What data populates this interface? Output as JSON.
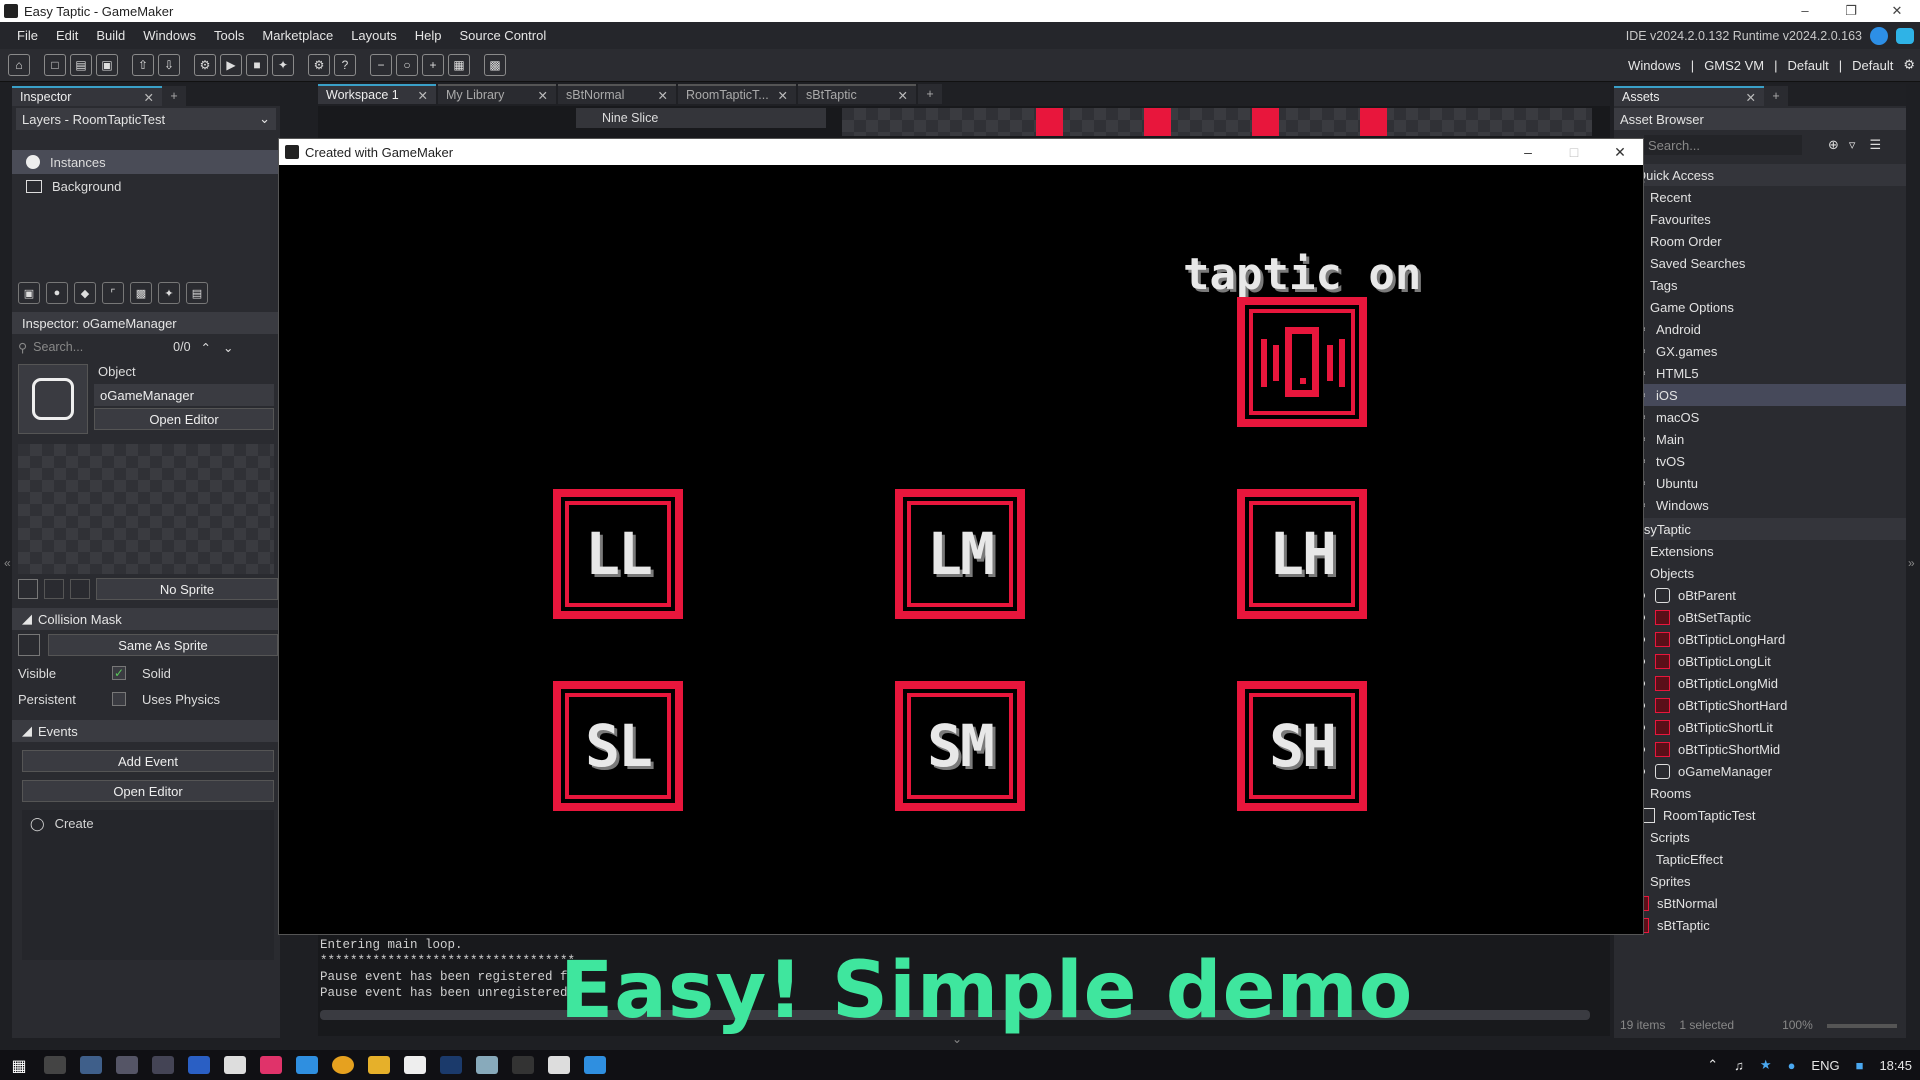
{
  "window": {
    "title": "Easy Taptic - GameMaker"
  },
  "menu": {
    "items": [
      "File",
      "Edit",
      "Build",
      "Windows",
      "Tools",
      "Marketplace",
      "Layouts",
      "Help",
      "Source Control"
    ],
    "version": "IDE v2024.2.0.132  Runtime v2024.2.0.163"
  },
  "toolbar": {
    "targets": [
      "Windows",
      "|",
      "GMS2 VM",
      "|",
      "Default",
      "|",
      "Default"
    ]
  },
  "left": {
    "inspector_tab": "Inspector",
    "layers_dropdown": "Layers - RoomTapticTest",
    "layers": [
      {
        "label": "Instances",
        "selected": true
      },
      {
        "label": "Background",
        "selected": false
      }
    ],
    "inspector_header": "Inspector: oGameManager",
    "search_placeholder": "Search...",
    "search_count": "0/0",
    "object_label": "Object",
    "object_name": "oGameManager",
    "open_editor": "Open Editor",
    "no_sprite": "No Sprite",
    "collision_mask": "Collision Mask",
    "same_as_sprite": "Same As Sprite",
    "visible": "Visible",
    "solid": "Solid",
    "persistent": "Persistent",
    "uses_physics": "Uses Physics",
    "events": "Events",
    "add_event": "Add Event",
    "open_editor2": "Open Editor",
    "event_create": "Create"
  },
  "workspace": {
    "tabs": [
      "Workspace 1",
      "My Library",
      "sBtNormal",
      "RoomTapticT...",
      "sBtTaptic"
    ],
    "nine_slice": "Nine Slice",
    "output": [
      "Entering main loop.",
      "**********************************",
      "Pause event has been registered fo",
      "Pause event has been unregistered"
    ]
  },
  "game": {
    "title": "Created with GameMaker",
    "taptic_label": "taptic on",
    "buttons": [
      "LL",
      "LM",
      "LH",
      "SL",
      "SM",
      "SH"
    ]
  },
  "right": {
    "assets_tab": "Assets",
    "asset_browser": "Asset Browser",
    "search_placeholder": "Search...",
    "quick_access": "Quick Access",
    "qa_items": [
      "Recent",
      "Favourites",
      "Room Order",
      "Saved Searches",
      "Tags",
      "Game Options"
    ],
    "game_options": [
      "Android",
      "GX.games",
      "HTML5",
      "iOS",
      "macOS",
      "Main",
      "tvOS",
      "Ubuntu",
      "Windows"
    ],
    "project": "EasyTaptic",
    "extensions": "Extensions",
    "objects": "Objects",
    "object_items": [
      "oBtParent",
      "oBtSetTaptic",
      "oBtTipticLongHard",
      "oBtTipticLongLit",
      "oBtTipticLongMid",
      "oBtTipticShortHard",
      "oBtTipticShortLit",
      "oBtTipticShortMid",
      "oGameManager"
    ],
    "rooms": "Rooms",
    "room_items": [
      "RoomTapticTest"
    ],
    "scripts": "Scripts",
    "script_items": [
      "TapticEffect"
    ],
    "sprites": "Sprites",
    "sprite_items": [
      "sBtNormal",
      "sBtTaptic"
    ],
    "status_items": "19 items",
    "status_selected": "1 selected",
    "zoom": "100%"
  },
  "overlay_text": "Easy! Simple demo",
  "taskbar": {
    "lang": "ENG",
    "time": "18:45"
  },
  "colors": {
    "accent_red": "#e8163c",
    "overlay_green": "#3fe69e"
  }
}
